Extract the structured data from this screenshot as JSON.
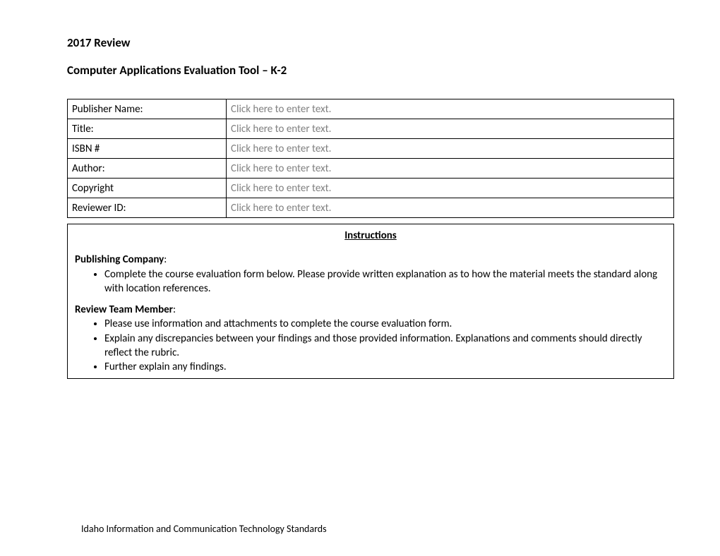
{
  "header": {
    "line1": "2017 Review",
    "line2": "Computer Applications Evaluation Tool – K-2"
  },
  "form_rows": [
    {
      "label": "Publisher Name:",
      "placeholder": "Click here to enter text."
    },
    {
      "label": "Title:",
      "placeholder": "Click here to enter text."
    },
    {
      "label": "ISBN #",
      "placeholder": "Click here to enter text."
    },
    {
      "label": "Author:",
      "placeholder": "Click here to enter text."
    },
    {
      "label": "Copyright",
      "placeholder": "Click here to enter text."
    },
    {
      "label": "Reviewer ID:",
      "placeholder": "Click here to enter text."
    }
  ],
  "instructions": {
    "title": "Instructions",
    "sections": [
      {
        "heading": "Publishing Company",
        "bullets": [
          "Complete the course evaluation form below. Please provide written explanation as to how the material meets the standard along with location references."
        ]
      },
      {
        "heading": "Review Team Member",
        "bullets": [
          "Please use information and attachments to complete the course evaluation form.",
          "Explain any discrepancies between your findings and those provided information.  Explanations and comments should directly reflect the rubric.",
          "Further explain any findings."
        ]
      }
    ]
  },
  "footer": "Idaho Information and Communication Technology Standards"
}
